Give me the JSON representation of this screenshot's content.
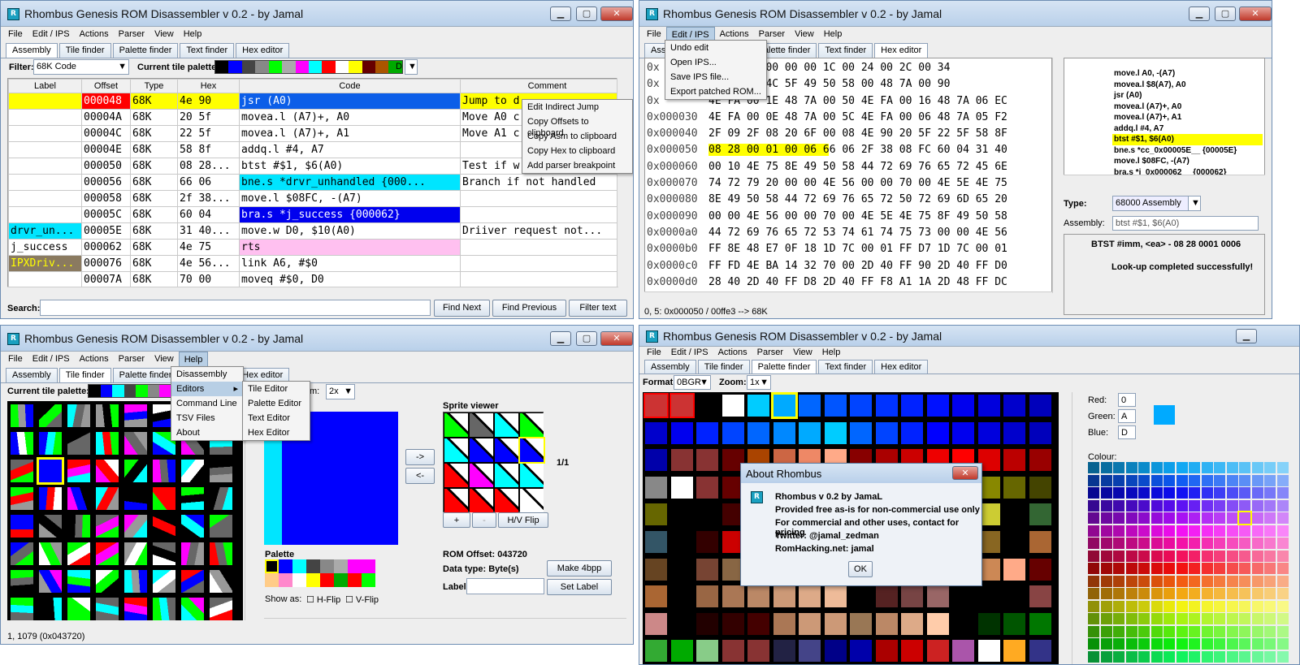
{
  "app": {
    "title": "Rhombus Genesis ROM Disassembler v 0.2 - by Jamal",
    "icon": "R"
  },
  "menus": [
    "File",
    "Edit / IPS",
    "Actions",
    "Parser",
    "View",
    "Help"
  ],
  "tabs": [
    "Assembly",
    "Tile finder",
    "Palette finder",
    "Text finder",
    "Hex editor"
  ],
  "w1": {
    "filter_label": "Filter:",
    "filter_value": "68K Code",
    "palette_label": "Current tile palette:",
    "palette_letter": "D",
    "headers": [
      "Label",
      "Offset",
      "Type",
      "Hex",
      "Code",
      "Comment"
    ],
    "rows": [
      {
        "label": "",
        "offset": "000048",
        "type": "68K",
        "hex": "4e 90",
        "code": "jsr  (A0)",
        "comment": "Jump to d"
      },
      {
        "label": "",
        "offset": "00004A",
        "type": "68K",
        "hex": "20 5f",
        "code": "movea.l  (A7)+, A0",
        "comment": "Move A0 c"
      },
      {
        "label": "",
        "offset": "00004C",
        "type": "68K",
        "hex": "22 5f",
        "code": "movea.l  (A7)+, A1",
        "comment": "Move A1 c"
      },
      {
        "label": "",
        "offset": "00004E",
        "type": "68K",
        "hex": "58 8f",
        "code": "addq.l  #4, A7",
        "comment": ""
      },
      {
        "label": "",
        "offset": "000050",
        "type": "68K",
        "hex": "08 28...",
        "code": "btst  #$1, $6(A0)",
        "comment": "Test if w"
      },
      {
        "label": "",
        "offset": "000056",
        "type": "68K",
        "hex": "66 06",
        "code": "bne.s  *drvr_unhandled  {000...",
        "comment": "Branch if not handled"
      },
      {
        "label": "",
        "offset": "000058",
        "type": "68K",
        "hex": "2f 38...",
        "code": "move.l  $08FC, -(A7)",
        "comment": ""
      },
      {
        "label": "",
        "offset": "00005C",
        "type": "68K",
        "hex": "60 04",
        "code": "bra.s  *j_success  {000062}",
        "comment": ""
      },
      {
        "label": "drvr_un...",
        "offset": "00005E",
        "type": "68K",
        "hex": "31 40...",
        "code": "move.w  D0, $10(A0)",
        "comment": "Driiver request not..."
      },
      {
        "label": "j_success",
        "offset": "000062",
        "type": "68K",
        "hex": "4e 75",
        "code": "rts",
        "comment": ""
      },
      {
        "label": "IPXDriv...",
        "offset": "000076",
        "type": "68K",
        "hex": "4e 56...",
        "code": "link A6, #$0",
        "comment": ""
      },
      {
        "label": "",
        "offset": "00007A",
        "type": "68K",
        "hex": "70 00",
        "code": "moveq  #$0, D0",
        "comment": ""
      }
    ],
    "context_menu": [
      "Edit Indirect Jump",
      "Copy Offsets to clipboard",
      "Copy Asm to clipboard",
      "Copy Hex to clipboard",
      "Add parser breakpoint"
    ],
    "search_label": "Search:",
    "find_next": "Find Next",
    "find_prev": "Find Previous",
    "filter_text": "Filter text"
  },
  "w2": {
    "edit_menu": [
      "Undo edit",
      "Open IPS...",
      "Save IPS file...",
      "Export patched ROM..."
    ],
    "hex_rows": [
      {
        "a": "0x",
        "b": "00 00 00 00 00 00 1C 00 24 00 2C 00 34"
      },
      {
        "a": "0x",
        "b": "2E 4E 56 4C 5F 49 50 58 00 48 7A 00 90"
      },
      {
        "a": "0x",
        "b": "4E FA 00 1E 48 7A 00 50 4E FA 00 16 48 7A 06 EC"
      },
      {
        "a": "0x000030",
        "b": "4E FA 00 0E 48 7A 00 5C 4E FA 00 06 48 7A 05 F2"
      },
      {
        "a": "0x000040",
        "b": "2F 09 2F 08 20 6F 00 08 4E 90 20 5F 22 5F 58 8F"
      },
      {
        "a": "0x000050",
        "b": "08 28 00 01 00 06 66 06 2F 38 08 FC 60 04 31 40"
      },
      {
        "a": "0x000060",
        "b": "00 10 4E 75 8E 49 50 58 44 72 69 76 65 72 45 6E"
      },
      {
        "a": "0x000070",
        "b": "74 72 79 20 00 00 4E 56 00 00 70 00 4E 5E 4E 75"
      },
      {
        "a": "0x000080",
        "b": "8E 49 50 58 44 72 69 76 65 72 50 72 69 6D 65 20"
      },
      {
        "a": "0x000090",
        "b": "00 00 4E 56 00 00 70 00 4E 5E 4E 75 8F 49 50 58"
      },
      {
        "a": "0x0000a0",
        "b": "44 72 69 76 65 72 53 74 61 74 75 73 00 00 4E 56"
      },
      {
        "a": "0x0000b0",
        "b": "FF 8E 48 E7 0F 18 1D 7C 00 01 FF D7 1D 7C 00 01"
      },
      {
        "a": "0x0000c0",
        "b": "FF FD 4E BA 14 32 70 00 2D 40 FF 90 2D 40 FF D0"
      },
      {
        "a": "0x0000d0",
        "b": "28 40 2D 40 FF D8 2D 40 FF F8 A1 1A 2D 48 FF DC"
      }
    ],
    "asm_lines": [
      "move.l A0, -(A7)",
      "movea.l $8(A7), A0",
      "jsr (A0)",
      "movea.l (A7)+, A0",
      "movea.l (A7)+, A1",
      "addq.l #4, A7",
      "btst #$1, $6(A0)",
      "bne.s *cc_0x00005E__ {00005E}",
      "move.l $08FC, -(A7)",
      "bra.s *j_0x000062__ {000062}"
    ],
    "type_label": "Type:",
    "type_value": "68000 Assembly",
    "asm_label": "Assembly:",
    "asm_value": "btst #$1, $6(A0)",
    "info1": "BTST    #imm, <ea> - 08 28 0001 0006",
    "info2": "Look-up completed successfully!",
    "status": "0, 5: 0x000050 / 00ffe3 --> 68K"
  },
  "w3": {
    "palette_label": "Current tile palette:",
    "zoom_label": "m:",
    "zoom_value": "2x",
    "help_menu": [
      "Disassembly",
      "Editors",
      "Command Line",
      "TSV Files",
      "About"
    ],
    "editors_sub": [
      "Tile Editor",
      "Palette Editor",
      "Text Editor",
      "Hex Editor"
    ],
    "sprite_viewer": "Sprite viewer",
    "page": "1/1",
    "btn_right": "->",
    "btn_left": "<-",
    "plus": "+",
    "minus": "-",
    "hvflip": "H/V Flip",
    "palette": "Palette",
    "rom_offset": "ROM Offset: 043720",
    "data_type": "Data type: Byte(s)",
    "label": "Label:",
    "make4bpp": "Make 4bpp",
    "set_label": "Set Label",
    "show_as": "Show as:",
    "hflip": "H-Flip",
    "vflip": "V-Flip",
    "status": "1, 1079 (0x043720)"
  },
  "w4": {
    "format_label": "Format:",
    "format_value": "0BGR",
    "zoom_label": "Zoom:",
    "zoom_value": "1x",
    "red": "Red:",
    "green": "Green:",
    "blue": "Blue:",
    "red_val": "0",
    "green_val": "A",
    "blue_val": "D",
    "colour": "Colour:",
    "about_title": "About Rhombus",
    "about_lines": [
      "Rhombus v 0.2 by JamaL",
      "Provided free as-is for non-commercial use only",
      "For commercial and other uses, contact for pricing",
      "Twitter: @jamal_zedman",
      "RomHacking.net: jamal"
    ],
    "ok": "OK"
  },
  "colors": {
    "accent": "#0c3cff",
    "cyan": "#00e5ff",
    "yellow": "#ffff00",
    "pink": "#ffc0f0",
    "red": "#ff0000"
  }
}
